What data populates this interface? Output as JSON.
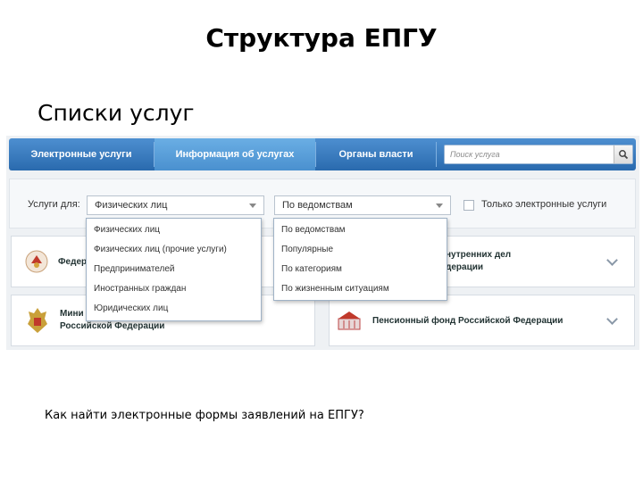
{
  "slide": {
    "title": "Структура ЕПГУ",
    "subtitle": "Списки услуг",
    "caption": "Как найти электронные формы заявлений на ЕПГУ?"
  },
  "navbar": {
    "tabs": [
      "Электронные услуги",
      "Информация об услугах",
      "Органы власти"
    ],
    "active_tab": "Информация об услугах",
    "search_placeholder": "Поиск услуга"
  },
  "filters": {
    "label": "Услуги для:",
    "audience_selected": "Физических лиц",
    "grouping_selected": "По ведомствам",
    "electronic_only_label": "Только электронные услуги",
    "electronic_only_checked": false,
    "audience_options": [
      "Физических лиц",
      "Физических лиц (прочие услуги)",
      "Предпринимателей",
      "Иностранных граждан",
      "Юридических лиц"
    ],
    "grouping_options": [
      "По ведомствам",
      "Популярные",
      "По категориям",
      "По жизненным ситуациям"
    ]
  },
  "cards": [
    {
      "text_line1": "Федер",
      "text_line2": ""
    },
    {
      "text_line1": "нутренних дел",
      "text_line2": "дерации"
    },
    {
      "text_line1": "Мини",
      "text_line2": "Российской Федерации"
    },
    {
      "text_line1": "Пенсионный фонд Российской Федерации",
      "text_line2": ""
    }
  ],
  "colors": {
    "nav_blue": "#2a6aae",
    "nav_active": "#5a9fdc",
    "panel_bg": "#eef1f4"
  }
}
